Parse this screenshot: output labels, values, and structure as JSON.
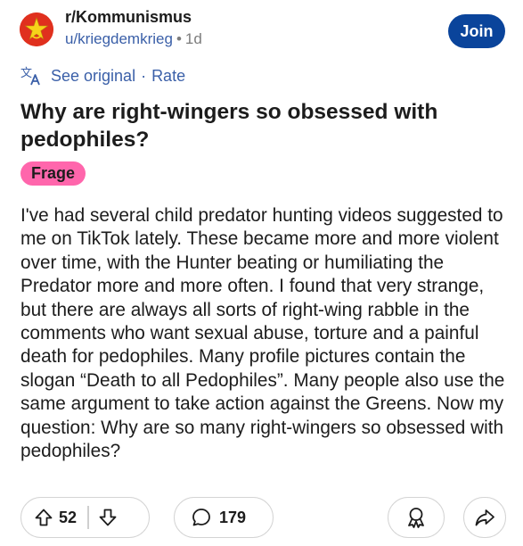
{
  "header": {
    "subreddit": "r/Kommunismus",
    "author": "u/kriegdemkrieg",
    "separator": "•",
    "age": "1d",
    "join_label": "Join"
  },
  "translate": {
    "see_original": "See original",
    "separator": "·",
    "rate": "Rate"
  },
  "post": {
    "title": "Why are right-wingers so obsessed with pedophiles?",
    "flair": "Frage",
    "body": "I've had several child predator hunting videos suggested to me on TikTok lately. These became more and more violent over time, with the Hunter beating or humiliating the Predator more and more often. I found that very strange, but there are always all sorts of right-wing rabble in the comments who want sexual abuse, torture and a painful death for pedophiles. Many profile pictures contain the slogan “Death to all Pedophiles”. Many people also use the same argument to take action against the Greens. Now my question: Why are so many right-wingers so obsessed with pedophiles?"
  },
  "actions": {
    "upvotes": "52",
    "comments": "179"
  },
  "icons": {
    "avatar": "soviet-star-avatar",
    "translate": "translate-icon",
    "upvote": "upvote-arrow-icon",
    "downvote": "downvote-arrow-icon",
    "comment": "comment-bubble-icon",
    "award": "award-icon",
    "share": "share-arrow-icon"
  },
  "colors": {
    "join_button": "#0a449b",
    "link": "#3a5fa8",
    "flair": "#ff66ac",
    "avatar": "#e0301e"
  }
}
